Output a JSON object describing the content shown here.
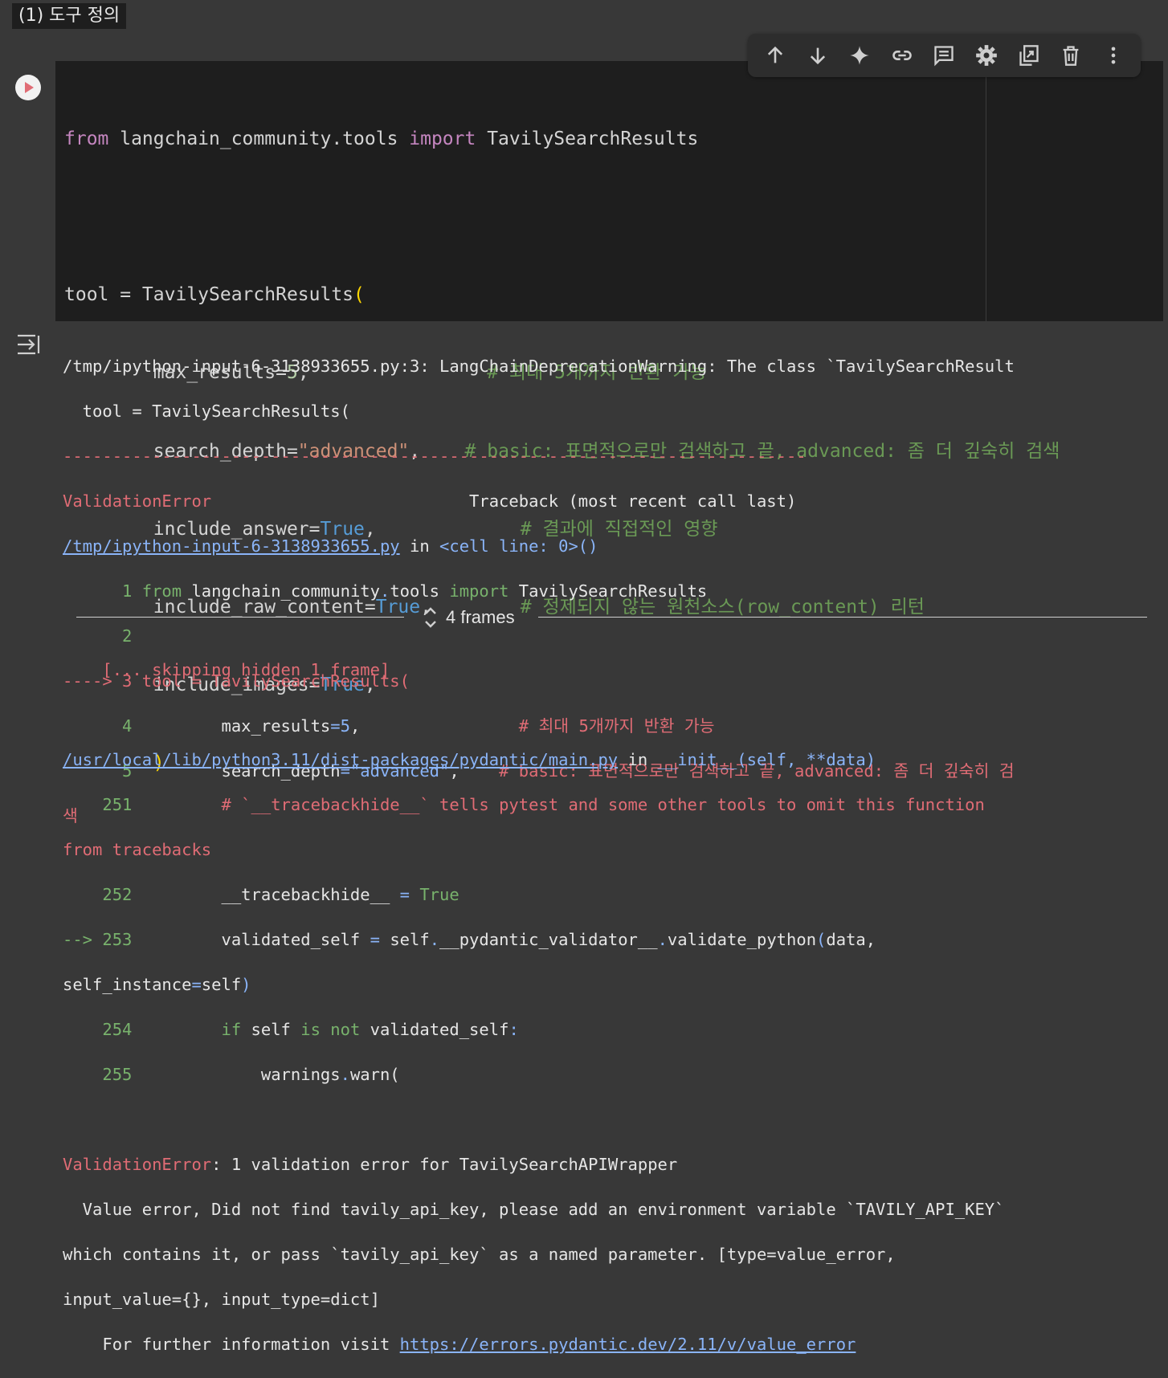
{
  "heading": "(1) 도구 정의",
  "toolbar": [
    "arrow-up-icon",
    "arrow-down-icon",
    "sparkle-icon",
    "link-icon",
    "comment-icon",
    "gear-icon",
    "mirror-cell-icon",
    "trash-icon",
    "more-vert-icon"
  ],
  "code": {
    "l1_from": "from",
    "l1_mod": " langchain_community.tools ",
    "l1_import": "import",
    "l1_cls": " TavilySearchResults",
    "l3_a": "tool = TavilySearchResults",
    "l3_p": "(",
    "l4_a": "        max_results=",
    "l4_n": "5",
    "l4_b": ",",
    "l4_c": "# 최대 5개까지 반환 가능",
    "l5_a": "        search_depth=",
    "l5_s": "\"advanced\"",
    "l5_b": ",",
    "l5_c": "# basic: 표면적으로만 검색하고 끝, advanced: 좀 더 깊숙히 검색",
    "l6_a": "        include_answer=",
    "l6_v": "True",
    "l6_b": ",",
    "l6_c": "# 결과에 직접적인 영향",
    "l7_a": "        include_raw_content=",
    "l7_v": "True",
    "l7_b": ",",
    "l7_c": "# 정제되지 않는 원천소스(row_content) 리턴",
    "l8_a": "        include_images=",
    "l8_v": "True",
    "l8_b": ",",
    "l9_p": "        )"
  },
  "output": {
    "warn1": "/tmp/ipython-input-6-3138933655.py:3: LangChainDeprecationWarning: The class `TavilySearchResult",
    "warn2": "  tool = TavilySearchResults(",
    "dashes": "---------------------------------------------------------------------------",
    "err_name": "ValidationError",
    "traceback_hdr": "                          Traceback (most recent call last)",
    "path1": "/tmp/ipython-input-6-3138933655.py",
    "path1_in": " in ",
    "path1_cell": "<cell line: 0>()",
    "t1_num": "      1 ",
    "t1_from": "from",
    "t1_mod": " langchain_community",
    "t1_dot": ".",
    "t1_tools": "tools ",
    "t1_import": "import",
    "t1_cls": " TavilySearchResults",
    "t2_num": "      2",
    "t3_arrow": "----> 3 ",
    "t3_code": "tool = TavilySearchResults(",
    "t4_num": "      4 ",
    "t4_a": "        max_results",
    "t4_eq": "=",
    "t4_n": "5",
    "t4_b": ",",
    "t4_c": "                # 최대 5개까지 반환 가능",
    "t5_num": "      5 ",
    "t5_a": "        search_depth",
    "t5_eq": "=",
    "t5_s": "\"advanced\"",
    "t5_b": ",",
    "t5_c": "    # basic: 표면적으로만 검색하고 끝, advanced: 좀 더 깊숙히 검",
    "t5_wrap": "색",
    "frames_label": "4 frames",
    "skip": "    [... skipping hidden 1 frame]",
    "path2": "/usr/local/lib/python3.11/dist-packages/pydantic/main.py",
    "path2_in": " in ",
    "path2_fn": "__init__(self, **data)",
    "p251_num": "    251 ",
    "p251_c": "        # `__tracebackhide__` tells pytest and some other tools to omit this function",
    "p251_wrap": "from tracebacks",
    "p252_num": "    252 ",
    "p252_a": "        __tracebackhide__ ",
    "p252_eq": "= ",
    "p252_v": "True",
    "p253_arrow": "--> 253 ",
    "p253_a": "        validated_self ",
    "p253_eq": "= ",
    "p253_b": "self",
    "p253_d1": ".",
    "p253_c": "__pydantic_validator__",
    "p253_d2": ".",
    "p253_e": "validate_python",
    "p253_p": "(",
    "p253_f": "data,",
    "p253_wrap1": "self_instance",
    "p253_wrap_eq": "=",
    "p253_wrap2": "self",
    "p253_wrap_p": ")",
    "p254_num": "    254 ",
    "p254_if": "        if",
    "p254_a": " self ",
    "p254_is": "is",
    "p254_sp": " ",
    "p254_not": "not",
    "p254_b": " validated_self",
    "p254_col": ":",
    "p255_num": "    255 ",
    "p255_a": "            warnings",
    "p255_d": ".",
    "p255_b": "warn(",
    "final_err": "ValidationError",
    "final_msg": ": 1 validation error for TavilySearchAPIWrapper",
    "final2": "  Value error, Did not find tavily_api_key, please add an environment variable `TAVILY_API_KEY`",
    "final3": "which contains it, or pass `tavily_api_key` as a named parameter. [type=value_error,",
    "final4": "input_value={}, input_type=dict]",
    "final5_pre": "    For further information visit ",
    "final5_link": "https://errors.pydantic.dev/2.11/v/value_error"
  }
}
